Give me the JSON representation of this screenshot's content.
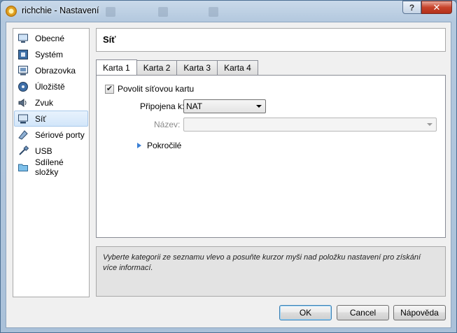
{
  "window": {
    "title": "richchie - Nastavení",
    "help_label": "?",
    "close_label": "✕"
  },
  "sidebar": {
    "items": [
      {
        "label": "Obecné",
        "icon": "monitor-icon"
      },
      {
        "label": "Systém",
        "icon": "chip-icon"
      },
      {
        "label": "Obrazovka",
        "icon": "display-icon"
      },
      {
        "label": "Úložiště",
        "icon": "disk-icon"
      },
      {
        "label": "Zvuk",
        "icon": "speaker-icon"
      },
      {
        "label": "Síť",
        "icon": "network-icon"
      },
      {
        "label": "Sériové porty",
        "icon": "serial-port-icon"
      },
      {
        "label": "USB",
        "icon": "usb-icon"
      },
      {
        "label": "Sdílené složky",
        "icon": "folder-icon"
      }
    ],
    "selected": "Síť"
  },
  "section": {
    "title": "Síť"
  },
  "tabs": [
    {
      "label": "Karta 1"
    },
    {
      "label": "Karta 2"
    },
    {
      "label": "Karta 3"
    },
    {
      "label": "Karta 4"
    }
  ],
  "adapter": {
    "enable_label": "Povolit síťovou kartu",
    "enabled": true,
    "attached_label": "Připojena k:",
    "attached_value": "NAT",
    "name_label": "Název:",
    "name_value": "",
    "advanced_label": "Pokročilé"
  },
  "info": {
    "text": "Vyberte kategorii ze seznamu vlevo a posuňte kurzor myši nad položku nastavení pro získání více informací."
  },
  "buttons": {
    "ok": "OK",
    "cancel": "Cancel",
    "help": "Nápověda"
  }
}
